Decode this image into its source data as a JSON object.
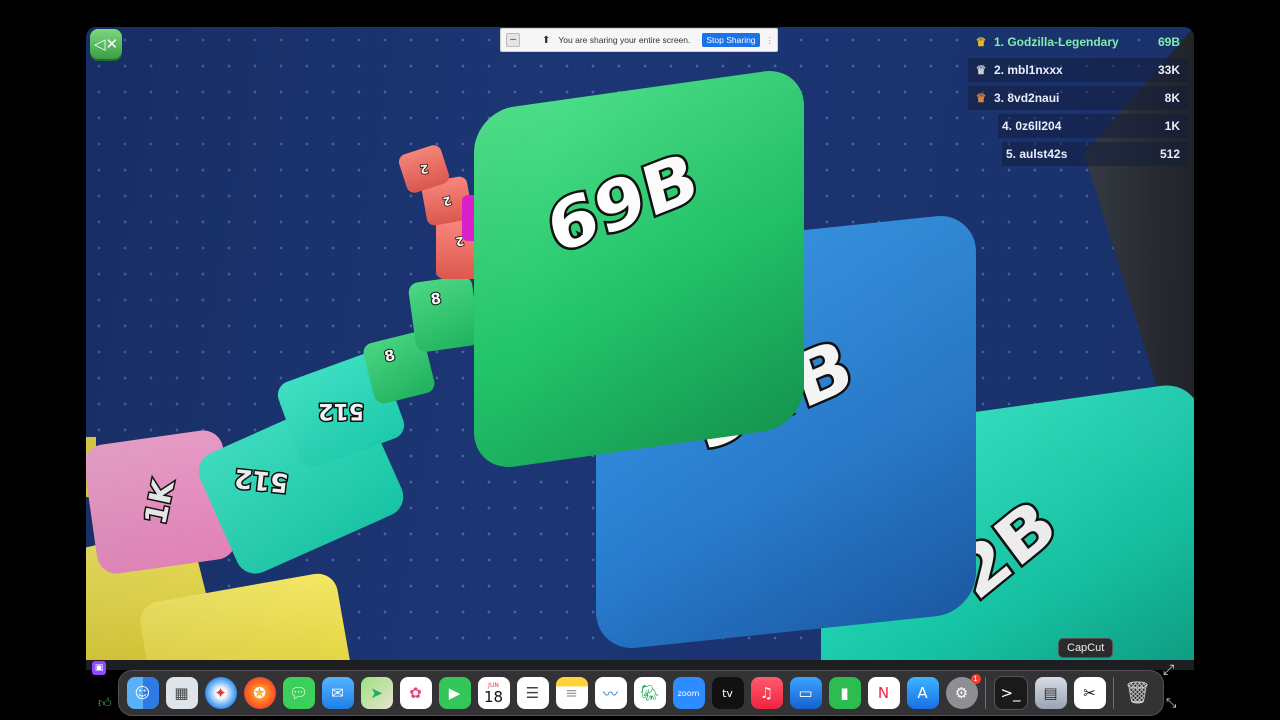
{
  "share_bar": {
    "minimize_label": "–",
    "message": "You are sharing your entire screen.",
    "stop_label": "Stop Sharing"
  },
  "leaderboard": [
    {
      "rank_name": "1. Godzilla-Legendary",
      "score": "69B",
      "crown": "gold"
    },
    {
      "rank_name": "2. mbl1nxxx",
      "score": "33K",
      "crown": "silver"
    },
    {
      "rank_name": "3. 8vd2naui",
      "score": "8K",
      "crown": "bronze"
    },
    {
      "rank_name": "4. 0z6ll204",
      "score": "1K",
      "crown": ""
    },
    {
      "rank_name": "5. aulst42s",
      "score": "512",
      "crown": ""
    }
  ],
  "cubes": {
    "c69b": "69B",
    "c34b": "34B",
    "c2b": "2B",
    "c512a": "512",
    "c512b": "512",
    "c1k": "1K",
    "c8a": "8",
    "c8b": "8",
    "c2a": "2",
    "c2b2": "2",
    "c2c": "2"
  },
  "colors": {
    "arena": "#1c3675",
    "leader": "#4fe08a",
    "player_gold": "#e8b923"
  },
  "tooltip": "CapCut",
  "dock": {
    "calendar_month": "JUN",
    "calendar_day": "18",
    "zoom_label": "zoom",
    "tv_label": "tv",
    "settings_badge": "1",
    "apps": [
      "finder-icon",
      "launchpad-icon",
      "safari-icon",
      "firefox-icon",
      "messages-icon",
      "mail-icon",
      "maps-icon",
      "photos-icon",
      "facetime-icon",
      "calendar-icon",
      "reminders-icon",
      "notes-icon",
      "freeform-icon",
      "evernote-icon",
      "zoom-icon",
      "apple-tv-icon",
      "music-icon",
      "keynote-icon",
      "numbers-icon",
      "news-icon",
      "app-store-icon",
      "system-settings-icon",
      "terminal-icon",
      "preview-icon",
      "capcut-icon",
      "trash-icon"
    ]
  }
}
